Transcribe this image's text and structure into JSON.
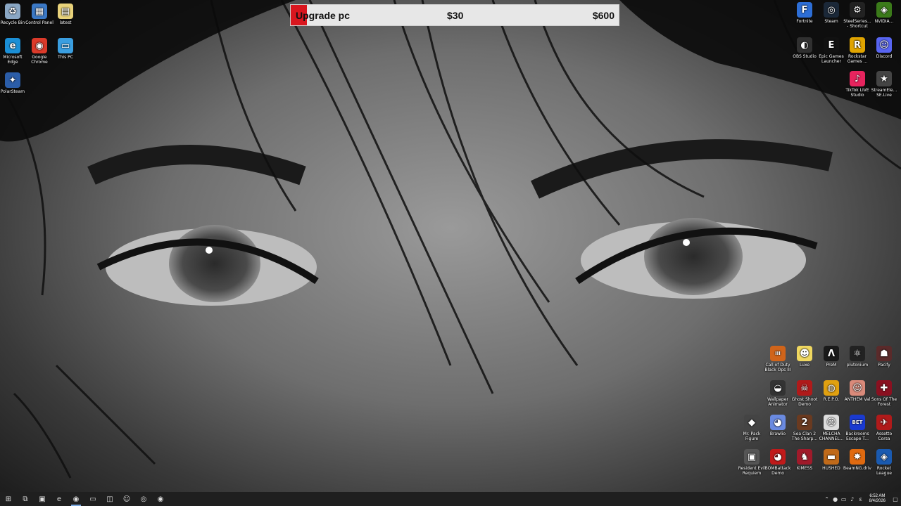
{
  "progress": {
    "label": "Upgrade pc",
    "current": "$30",
    "goal": "$600",
    "fraction": 0.05,
    "fill_color": "#d9161e"
  },
  "desktop_left": [
    {
      "id": "recycle-bin",
      "label": "Recycle Bin",
      "icon": "recycle-bin-icon",
      "color": "#8aa7c4",
      "glyph": "♻"
    },
    {
      "id": "control-panel",
      "label": "Control Panel",
      "icon": "control-panel-icon",
      "color": "#3b78c4",
      "glyph": "▦"
    },
    {
      "id": "latest",
      "label": "latest",
      "icon": "file-icon",
      "color": "#e8d27a",
      "glyph": "▤"
    },
    {
      "id": "edge",
      "label": "Microsoft Edge",
      "icon": "edge-icon",
      "color": "#1b8fd6",
      "glyph": "e"
    },
    {
      "id": "chrome",
      "label": "Google Chrome",
      "icon": "chrome-icon",
      "color": "#db3a2a",
      "glyph": "◉"
    },
    {
      "id": "this-pc",
      "label": "This PC",
      "icon": "computer-icon",
      "color": "#3a9ee0",
      "glyph": "▭"
    },
    {
      "id": "polarsteam",
      "label": "PolarSteam",
      "icon": "polarsteam-icon",
      "color": "#2b5da8",
      "glyph": "✦"
    }
  ],
  "desktop_right_top": [
    {
      "id": "fortnite",
      "label": "Fortnite",
      "icon": "fortnite-icon",
      "color": "#2d6ed6",
      "glyph": "F"
    },
    {
      "id": "steam",
      "label": "Steam",
      "icon": "steam-icon",
      "color": "#1b2838",
      "glyph": "◎"
    },
    {
      "id": "steelseries",
      "label": "SteelSeries... - Shortcut",
      "icon": "steelseries-icon",
      "color": "#222",
      "glyph": "⚙"
    },
    {
      "id": "nvidia",
      "label": "NVIDIA...",
      "icon": "nvidia-icon",
      "color": "#3b7a1a",
      "glyph": "◈"
    },
    {
      "id": "obs",
      "label": "OBS Studio",
      "icon": "obs-icon",
      "color": "#303030",
      "glyph": "◐"
    },
    {
      "id": "epic",
      "label": "Epic Games Launcher",
      "icon": "epic-games-icon",
      "color": "#111",
      "glyph": "E"
    },
    {
      "id": "rockstar",
      "label": "Rockstar Games ...",
      "icon": "rockstar-icon",
      "color": "#e0a400",
      "glyph": "R"
    },
    {
      "id": "discord",
      "label": "Discord",
      "icon": "discord-icon",
      "color": "#5865f2",
      "glyph": "☺"
    },
    {
      "id": "tiktok",
      "label": "TikTok LIVE Studio",
      "icon": "tiktok-icon",
      "color": "#e6245e",
      "glyph": "♪"
    },
    {
      "id": "streamelements",
      "label": "StreamEle... SE.Live",
      "icon": "streamelements-icon",
      "color": "#444",
      "glyph": "★"
    }
  ],
  "desktop_right_bottom": [
    {
      "id": "cod",
      "label": "Call of Duty Black Ops III",
      "icon": "call-of-duty-icon",
      "color": "#d0641a",
      "glyph": "III"
    },
    {
      "id": "luxe",
      "label": "Luxe",
      "icon": "luxe-icon",
      "color": "#f0d860",
      "glyph": "☻"
    },
    {
      "id": "prem",
      "label": "PreM",
      "icon": "prem-icon",
      "color": "#1a1a1a",
      "glyph": "Λ"
    },
    {
      "id": "plutonium",
      "label": "plutonium",
      "icon": "plutonium-icon",
      "color": "#222",
      "glyph": "⚛"
    },
    {
      "id": "pacify",
      "label": "Pacify",
      "icon": "pacify-icon",
      "color": "#5a2a2a",
      "glyph": "☗"
    },
    {
      "id": "wallpaper-animator",
      "label": "Wallpaper Animator",
      "icon": "wallpaper-animator-icon",
      "color": "#333",
      "glyph": "◒"
    },
    {
      "id": "ghost-demo",
      "label": "Ghost Shoot Demo",
      "icon": "ghost-demo-icon",
      "color": "#b01a1a",
      "glyph": "☠"
    },
    {
      "id": "repo",
      "label": "R.E.P.O.",
      "icon": "repo-icon",
      "color": "#e0a010",
      "glyph": "◍"
    },
    {
      "id": "anthem",
      "label": "ANTHEM Val",
      "icon": "anthem-icon",
      "color": "#d98a7a",
      "glyph": "☺"
    },
    {
      "id": "sons-forest",
      "label": "Sons Of The Forest",
      "icon": "sons-forest-icon",
      "color": "#8a1020",
      "glyph": "✚"
    },
    {
      "id": "mr-pack",
      "label": "Mr. Pack Figure",
      "icon": "mr-pack-icon",
      "color": "#444",
      "glyph": "◆"
    },
    {
      "id": "brawlio",
      "label": "Brawlio",
      "icon": "brawlio-icon",
      "color": "#6a8ae0",
      "glyph": "◕"
    },
    {
      "id": "sea-sharp",
      "label": "Sea Clan 2 The Sharp...",
      "icon": "sea-clan-icon",
      "color": "#6a3a20",
      "glyph": "2"
    },
    {
      "id": "melonchat",
      "label": "MELCHA CHANNEL...",
      "icon": "melchat-icon",
      "color": "#ddd",
      "glyph": "☺"
    },
    {
      "id": "backrooms",
      "label": "Backrooms Escape T...",
      "icon": "backrooms-icon",
      "color": "#1a3ad0",
      "glyph": "BET"
    },
    {
      "id": "assetto",
      "label": "Assetto Corsa",
      "icon": "assetto-icon",
      "color": "#b01a1a",
      "glyph": "✈"
    },
    {
      "id": "resident",
      "label": "Resident Evil Requiem",
      "icon": "resident-evil-icon",
      "color": "#555",
      "glyph": "▣"
    },
    {
      "id": "bombattack",
      "label": "BOMBattack Demo",
      "icon": "bombattack-icon",
      "color": "#c01a1a",
      "glyph": "◕"
    },
    {
      "id": "kimess",
      "label": "KIMESS",
      "icon": "kimess-icon",
      "color": "#a01a2a",
      "glyph": "♞"
    },
    {
      "id": "hushed",
      "label": "HUSHED",
      "icon": "hushed-icon",
      "color": "#c06a1a",
      "glyph": "▬"
    },
    {
      "id": "beamng",
      "label": "BeamNG.drive",
      "icon": "beamng-icon",
      "color": "#e06a10",
      "glyph": "✸"
    },
    {
      "id": "rocket-league",
      "label": "Rocket League",
      "icon": "rocket-league-icon",
      "color": "#1a5ab0",
      "glyph": "◈"
    }
  ],
  "taskbar": {
    "items": [
      {
        "id": "start",
        "icon": "windows-start-icon",
        "glyph": "⊞"
      },
      {
        "id": "task-view",
        "icon": "task-view-icon",
        "glyph": "⧉"
      },
      {
        "id": "store",
        "icon": "store-icon",
        "glyph": "▣"
      },
      {
        "id": "edge",
        "icon": "edge-icon",
        "glyph": "e"
      },
      {
        "id": "chrome",
        "icon": "chrome-icon",
        "glyph": "◉"
      },
      {
        "id": "explorer",
        "icon": "file-explorer-icon",
        "glyph": "▭"
      },
      {
        "id": "app1",
        "icon": "app-icon",
        "glyph": "◫"
      },
      {
        "id": "discord",
        "icon": "discord-icon",
        "glyph": "☺"
      },
      {
        "id": "steam",
        "icon": "steam-icon",
        "glyph": "◎"
      },
      {
        "id": "record",
        "icon": "record-icon",
        "glyph": "◉"
      }
    ],
    "time": "6:52 AM",
    "date": "8/4/2026"
  }
}
